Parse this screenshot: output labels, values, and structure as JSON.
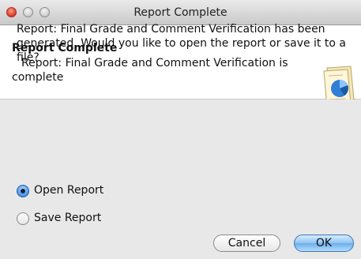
{
  "window": {
    "title": "Report Complete"
  },
  "header": {
    "title": "Report Complete",
    "description": "Report: Final Grade and Comment Verification is complete",
    "icon": "report-document-icon"
  },
  "body": {
    "message": "Report: Final Grade and Comment Verification has been generated. Would you like to open the report or save it to a file?",
    "options": [
      {
        "label": "Open Report",
        "selected": true
      },
      {
        "label": "Save Report",
        "selected": false
      }
    ]
  },
  "buttons": {
    "cancel_label": "Cancel",
    "ok_label": "OK"
  },
  "colors": {
    "default_button": "#8fc3f2",
    "header_background": "#ffffff",
    "body_background": "#e8e8e8"
  }
}
